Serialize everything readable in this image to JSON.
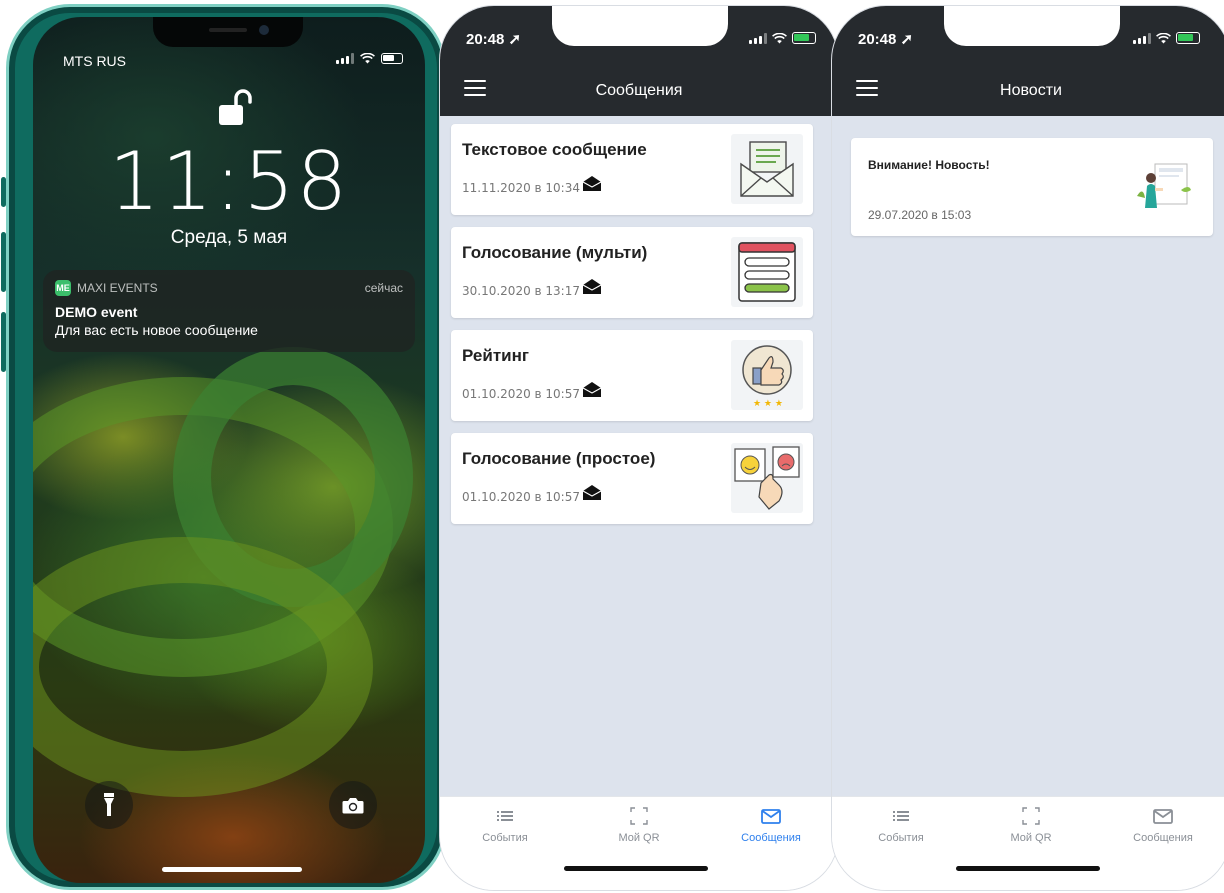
{
  "lock_screen": {
    "carrier": "MTS RUS",
    "time": "11:58",
    "date": "Среда, 5 мая",
    "notification": {
      "app_name": "MAXI EVENTS",
      "app_badge": "ME",
      "time": "сейчас",
      "title": "DEMO event",
      "body": "Для вас есть новое сообщение"
    },
    "flashlight_icon": "flashlight-icon",
    "camera_icon": "camera-icon"
  },
  "messages_screen": {
    "status_time": "20:48",
    "title": "Сообщения",
    "cards": [
      {
        "title": "Текстовое сообщение",
        "date": "11.11.2020 в 10:34",
        "image": "letter-envelope-image"
      },
      {
        "title": "Голосование (мульти)",
        "date": "30.10.2020 в 13:17",
        "image": "multi-vote-form-image"
      },
      {
        "title": "Рейтинг",
        "date": "01.10.2020 в 10:57",
        "image": "thumbs-up-rating-image"
      },
      {
        "title": "Голосование (простое)",
        "date": "01.10.2020 в 10:57",
        "image": "simple-vote-faces-image"
      }
    ],
    "tabs": [
      {
        "label": "События",
        "icon": "list-icon",
        "active": false
      },
      {
        "label": "Мой QR",
        "icon": "qr-frame-icon",
        "active": false
      },
      {
        "label": "Сообщения",
        "icon": "mail-icon",
        "active": true
      }
    ]
  },
  "news_screen": {
    "status_time": "20:48",
    "title": "Новости",
    "cards": [
      {
        "title": "Внимание! Новость!",
        "date": "29.07.2020 в 15:03",
        "image": "person-presenting-image"
      }
    ],
    "tabs": [
      {
        "label": "События",
        "icon": "list-icon",
        "active": false
      },
      {
        "label": "Мой QR",
        "icon": "qr-frame-icon",
        "active": false
      },
      {
        "label": "Сообщения",
        "icon": "mail-icon",
        "active": false
      }
    ]
  },
  "colors": {
    "header_bg": "#262a2e",
    "body_bg": "#dde3ed",
    "active_tab": "#2f80ed",
    "phone_frame": "#0f6b5f",
    "battery_charging": "#33c759"
  }
}
